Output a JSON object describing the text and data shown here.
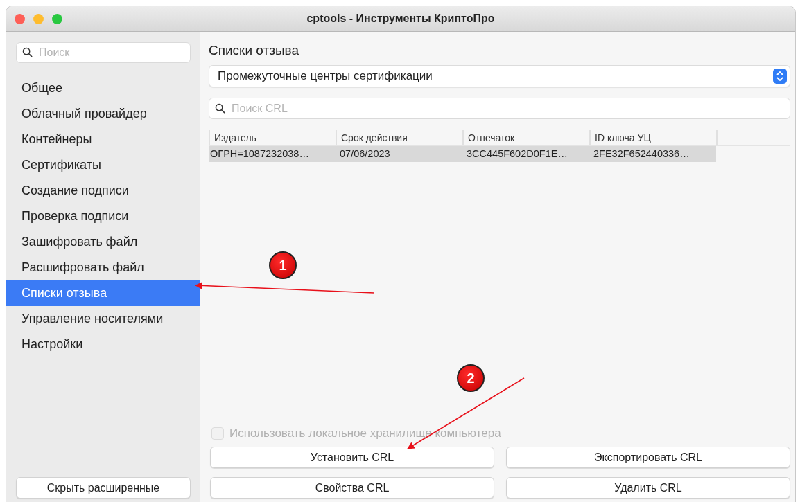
{
  "window": {
    "title": "cptools - Инструменты КриптоПро"
  },
  "sidebar": {
    "search": {
      "placeholder": "Поиск"
    },
    "items": [
      {
        "label": "Общее",
        "selected": false
      },
      {
        "label": "Облачный провайдер",
        "selected": false
      },
      {
        "label": "Контейнеры",
        "selected": false
      },
      {
        "label": "Сертификаты",
        "selected": false
      },
      {
        "label": "Создание подписи",
        "selected": false
      },
      {
        "label": "Проверка подписи",
        "selected": false
      },
      {
        "label": "Зашифровать файл",
        "selected": false
      },
      {
        "label": "Расшифровать файл",
        "selected": false
      },
      {
        "label": "Списки отзыва",
        "selected": true
      },
      {
        "label": "Управление носителями",
        "selected": false
      },
      {
        "label": "Настройки",
        "selected": false
      }
    ],
    "button": "Скрыть расширенные"
  },
  "main": {
    "heading": "Списки отзыва",
    "select": {
      "value": "Промежуточные центры сертификации"
    },
    "search": {
      "placeholder": "Поиск CRL"
    },
    "table": {
      "columns": [
        "Издатель",
        "Срок действия",
        "Отпечаток",
        "ID ключа УЦ"
      ],
      "rows": [
        {
          "cells": [
            "ОГРН=1087232038…",
            "07/06/2023",
            "3CC445F602D0F1E…",
            "2FE32F652440336…"
          ],
          "selected": true
        }
      ]
    },
    "checkbox": {
      "label": "Использовать локальное хранилище компьютера",
      "checked": false,
      "disabled": true
    },
    "buttons": [
      "Установить CRL",
      "Экспортировать CRL",
      "Свойства CRL",
      "Удалить CRL"
    ]
  },
  "annotations": [
    {
      "label": "1"
    },
    {
      "label": "2"
    }
  ]
}
